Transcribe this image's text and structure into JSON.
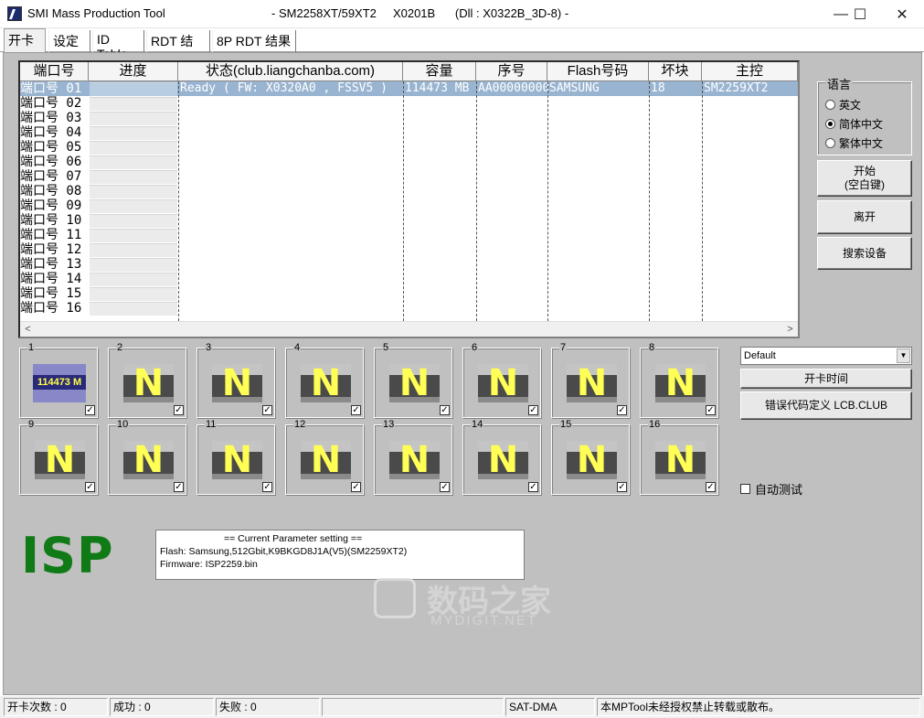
{
  "window": {
    "app_title": "SMI Mass Production Tool",
    "title_detail": "- SM2258XT/59XT2     X0201B      (Dll : X0322B_3D-8) -",
    "minimize": "—",
    "maximize": "☐",
    "close": "✕"
  },
  "tabs": [
    {
      "label": "开卡"
    },
    {
      "label": "设定"
    },
    {
      "label": "ID Table"
    },
    {
      "label": "RDT 结果"
    },
    {
      "label": "8P RDT 结果"
    }
  ],
  "table": {
    "headers": [
      "端口号",
      "进度",
      "状态(club.liangchanba.com)",
      "容量",
      "序号",
      "Flash号码",
      "坏块",
      "主控"
    ],
    "ports": [
      "端口号 01",
      "端口号 02",
      "端口号 03",
      "端口号 04",
      "端口号 05",
      "端口号 06",
      "端口号 07",
      "端口号 08",
      "端口号 09",
      "端口号 10",
      "端口号 11",
      "端口号 12",
      "端口号 13",
      "端口号 14",
      "端口号 15",
      "端口号 16"
    ],
    "row1": {
      "status": "Ready ( FW: X0320A0 , FSSV5 )",
      "capacity": "114473 MB",
      "serial": "AA00000000",
      "flash": "SAMSUNG",
      "bad_blocks": "18",
      "controller": "SM2259XT2"
    },
    "scroll_left": "<",
    "scroll_right": ">"
  },
  "language": {
    "title": "语言",
    "options": [
      {
        "label": "英文",
        "selected": false
      },
      {
        "label": "简体中文",
        "selected": true
      },
      {
        "label": "繁体中文",
        "selected": false
      }
    ]
  },
  "buttons": {
    "start_line1": "开始",
    "start_line2": "(空白键)",
    "exit": "离开",
    "search": "搜索设备",
    "open_time": "开卡时间",
    "error_code": "错误代码定义 LCB.CLUB"
  },
  "profile_select": {
    "value": "Default",
    "arrow": "▼"
  },
  "devices": {
    "numbers": [
      "1",
      "2",
      "3",
      "4",
      "5",
      "6",
      "7",
      "8",
      "9",
      "10",
      "11",
      "12",
      "13",
      "14",
      "15",
      "16"
    ],
    "first_capacity": "114473 M",
    "empty_glyph": "N",
    "check_mark": "✓"
  },
  "auto_test": {
    "label": "自动测试"
  },
  "isp_label": "ISP",
  "params": {
    "header": "== Current Parameter setting ==",
    "flash_line": "Flash:   Samsung,512Gbit,K9BKGD8J1A(V5)(SM2259XT2)",
    "firmware_line": "Firmware:   ISP2259.bin"
  },
  "watermark": {
    "cn": "数码之家",
    "en": "MYDIGIT.NET"
  },
  "status": {
    "open_count": "开卡次数 : 0",
    "success": "成功 : 0",
    "fail": "失败 : 0",
    "empty": "",
    "mode": "SAT-DMA",
    "notice": "本MPTool未经授权禁止转载或散布。"
  },
  "colors": {
    "isp_green": "#0f7a16",
    "selection": "#99b4d1",
    "panel": "#c0c0c0"
  }
}
